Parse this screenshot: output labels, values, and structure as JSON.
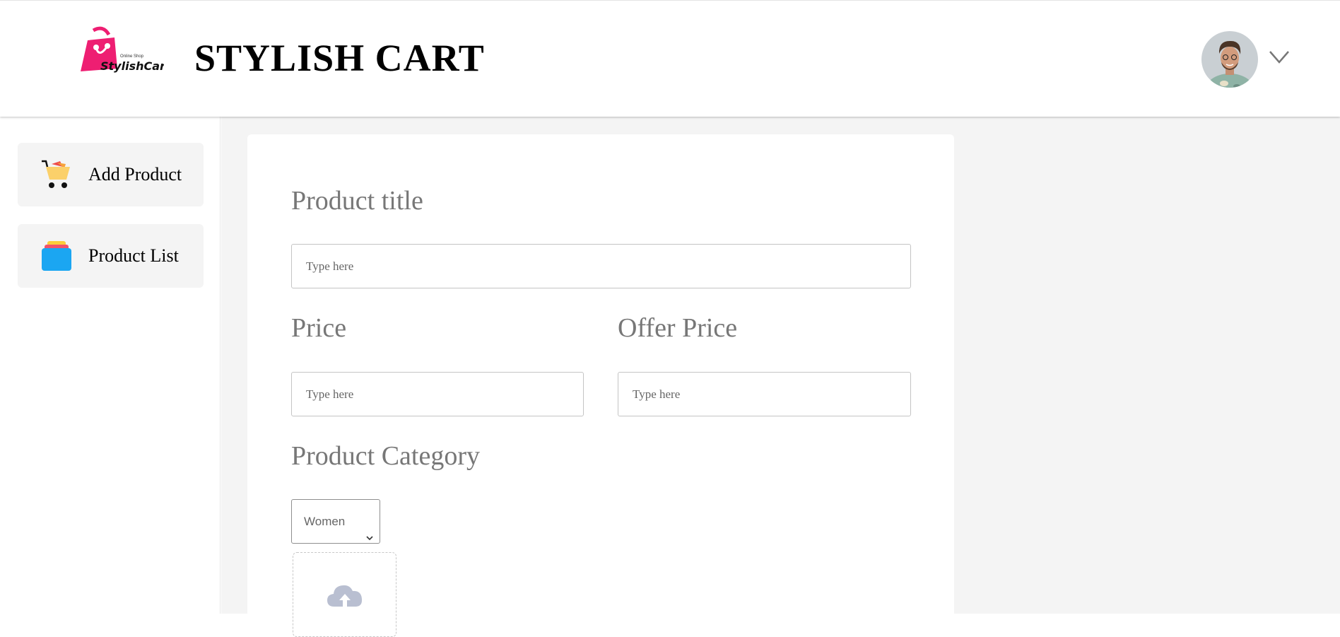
{
  "header": {
    "logo_text": "StylishCart",
    "logo_tagline": "Online Shop",
    "title": "STYLISH CART",
    "brand_color": "#ee1e72"
  },
  "user_menu": {
    "avatar_icon": "user-avatar",
    "dropdown_icon": "chevron-down-icon"
  },
  "sidebar": {
    "items": [
      {
        "label": "Add Product",
        "icon": "cart-icon"
      },
      {
        "label": "Product List",
        "icon": "stacked-list-icon"
      }
    ]
  },
  "form": {
    "product_title": {
      "label": "Product title",
      "placeholder": "Type here"
    },
    "price": {
      "label": "Price",
      "placeholder": "Type here"
    },
    "offer_price": {
      "label": "Offer Price",
      "placeholder": "Type here"
    },
    "category": {
      "label": "Product Category",
      "selected": "Women"
    },
    "upload": {
      "icon": "cloud-upload-icon"
    }
  }
}
